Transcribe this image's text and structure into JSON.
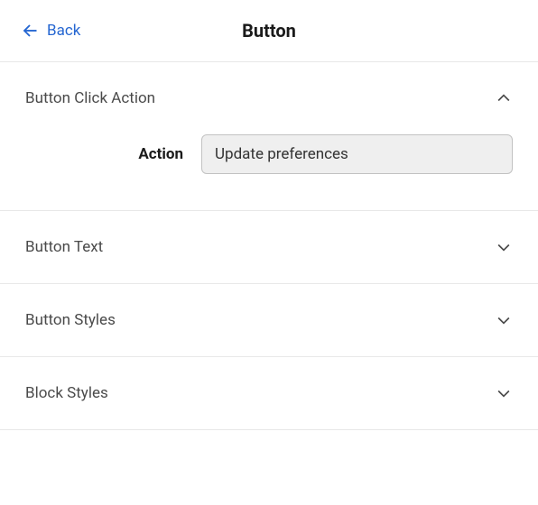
{
  "header": {
    "back_label": "Back",
    "title": "Button"
  },
  "sections": {
    "click_action": {
      "title": "Button Click Action",
      "action_label": "Action",
      "action_value": "Update preferences"
    },
    "button_text": {
      "title": "Button Text"
    },
    "button_styles": {
      "title": "Button Styles"
    },
    "block_styles": {
      "title": "Block Styles"
    }
  }
}
